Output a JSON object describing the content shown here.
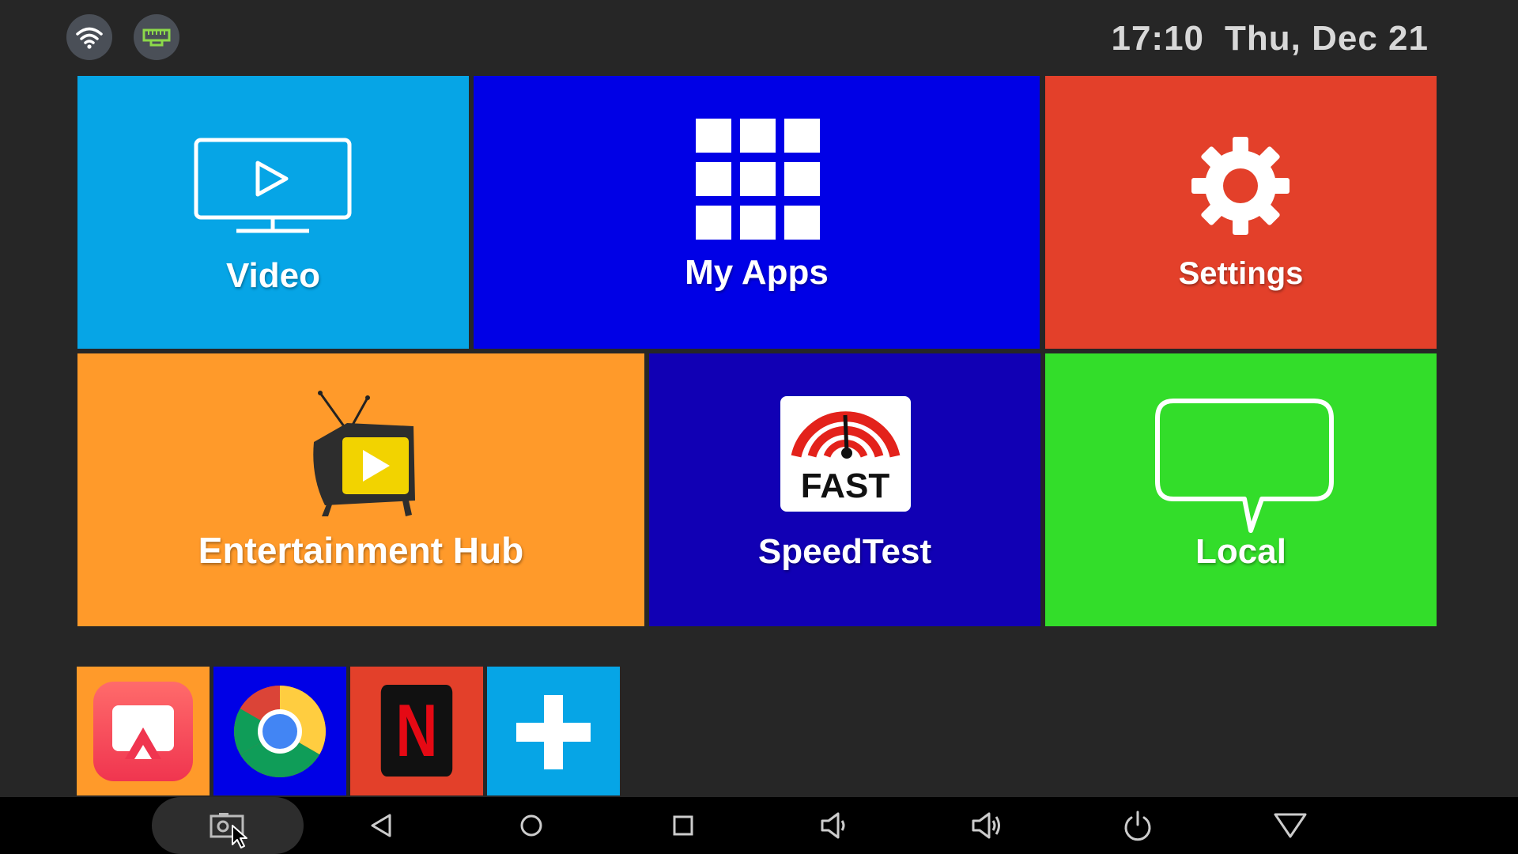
{
  "status_bar": {
    "time": "17:10",
    "date": "Thu, Dec 21",
    "icons": [
      "wifi-icon",
      "ethernet-icon"
    ]
  },
  "tiles": {
    "video": {
      "label": "Video",
      "color": "#06a5e6"
    },
    "my_apps": {
      "label": "My Apps",
      "color": "#0000e6"
    },
    "settings": {
      "label": "Settings",
      "color": "#e3402a"
    },
    "entertainment_hub": {
      "label": "Entertainment Hub",
      "color": "#ff9a2a"
    },
    "speedtest": {
      "label": "SpeedTest",
      "icon_text": "FAST",
      "color": "#1100b4"
    },
    "local": {
      "label": "Local",
      "color": "#33dd2a"
    }
  },
  "shortcuts": [
    {
      "name": "airscreen-app",
      "color": "#ff9a2a"
    },
    {
      "name": "chrome-app",
      "color": "#0000e6"
    },
    {
      "name": "netflix-app",
      "icon_text": "N",
      "color": "#e3402a"
    },
    {
      "name": "add-app",
      "color": "#06a5e6"
    }
  ],
  "nav_bar": {
    "buttons": [
      "screenshot",
      "back",
      "home",
      "recents",
      "volume-down",
      "volume-up",
      "power",
      "hide-bar"
    ]
  }
}
